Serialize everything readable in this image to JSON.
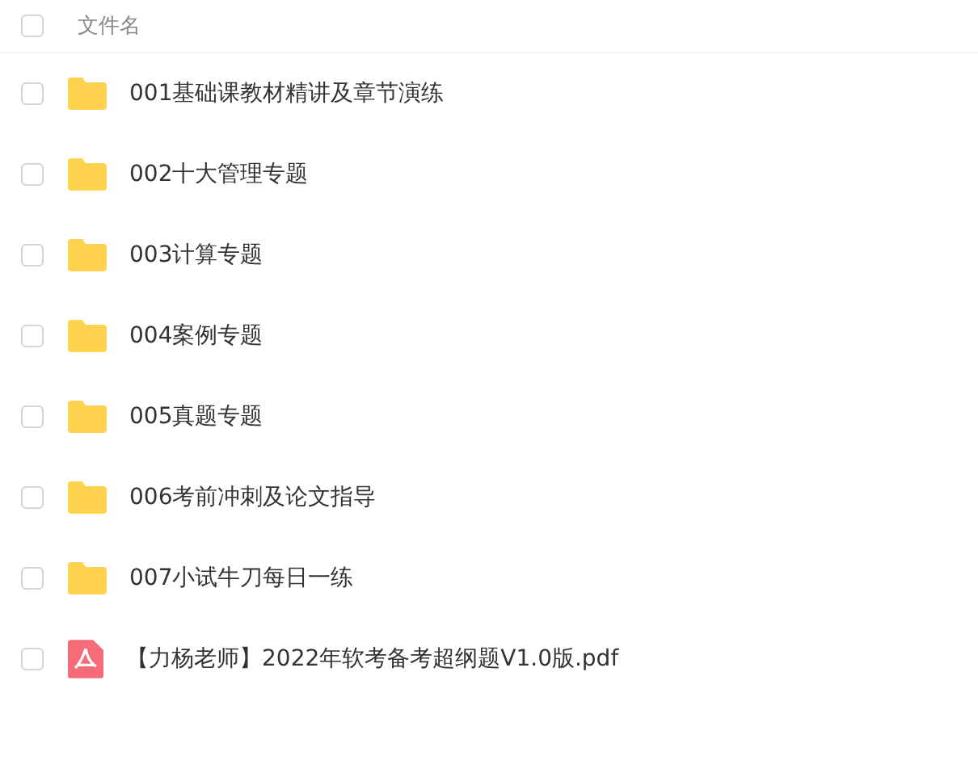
{
  "header": {
    "checked": false,
    "label": "文件名"
  },
  "files": [
    {
      "kind": "folder",
      "name": "001基础课教材精讲及章节演练",
      "checked": false
    },
    {
      "kind": "folder",
      "name": "002十大管理专题",
      "checked": false
    },
    {
      "kind": "folder",
      "name": "003计算专题",
      "checked": false
    },
    {
      "kind": "folder",
      "name": "004案例专题",
      "checked": false
    },
    {
      "kind": "folder",
      "name": "005真题专题",
      "checked": false
    },
    {
      "kind": "folder",
      "name": "006考前冲刺及论文指导",
      "checked": false
    },
    {
      "kind": "folder",
      "name": "007小试牛刀每日一练",
      "checked": false
    },
    {
      "kind": "pdf",
      "name": "【力杨老师】2022年软考备考超纲题V1.0版.pdf",
      "checked": false
    }
  ]
}
